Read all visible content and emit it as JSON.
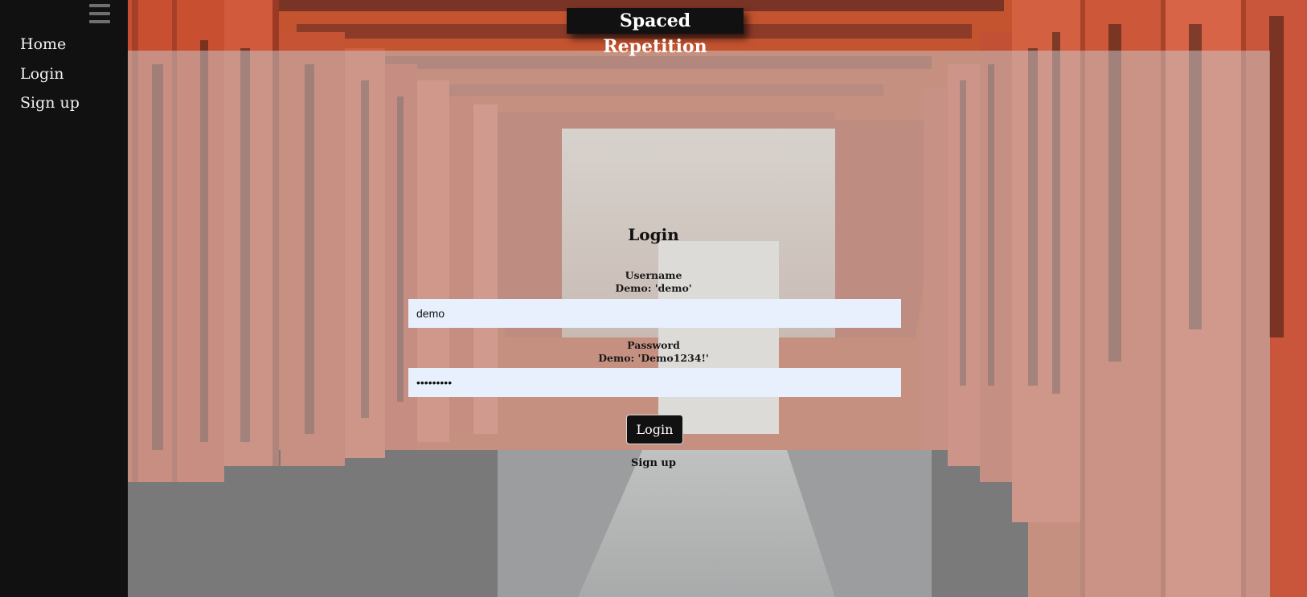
{
  "app": {
    "title": "Spaced Repetition"
  },
  "sidebar": {
    "items": [
      {
        "label": "Home"
      },
      {
        "label": "Login"
      },
      {
        "label": "Sign up"
      }
    ]
  },
  "login_form": {
    "heading": "Login",
    "username": {
      "label": "Username",
      "hint": "Demo: 'demo'",
      "value": "demo"
    },
    "password": {
      "label": "Password",
      "hint": "Demo: 'Demo1234!'",
      "value": "Demo1234!"
    },
    "submit_label": "Login",
    "signup_link": "Sign up"
  },
  "colors": {
    "sidebar": "#111111",
    "torii_orange": "#d0583b",
    "overlay": "#c8cdd2",
    "input_bg": "#e8f0fe"
  },
  "icons": {
    "menu": "hamburger-menu-icon"
  }
}
